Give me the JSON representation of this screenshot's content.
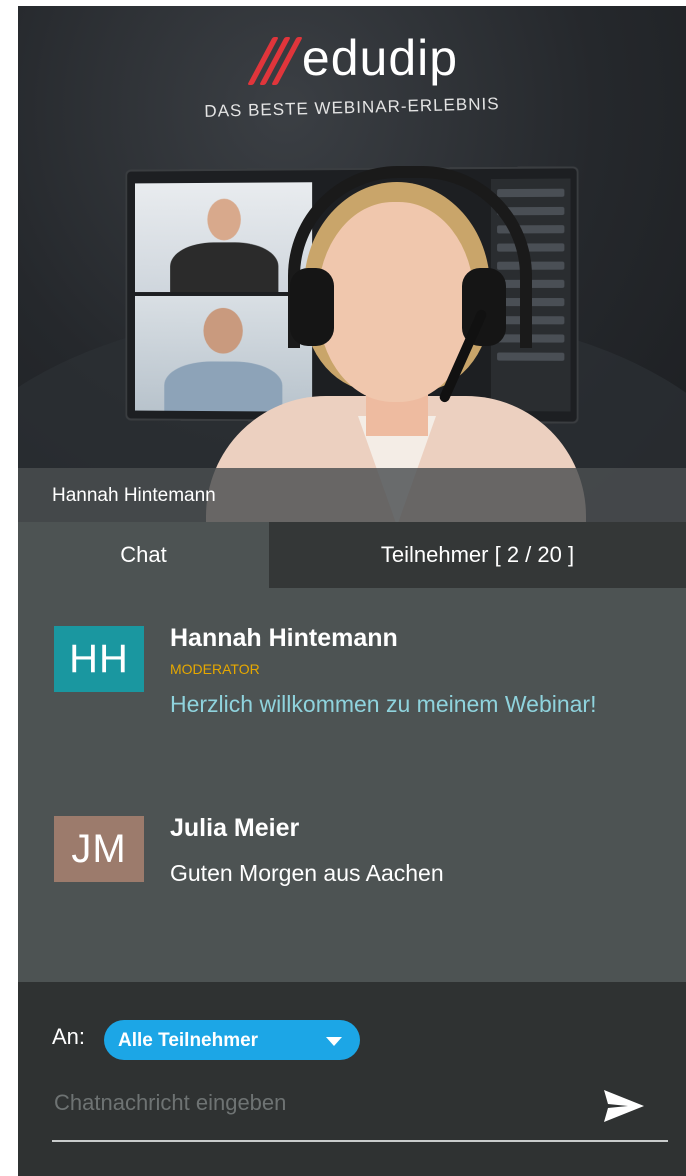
{
  "video": {
    "brand": "edudip",
    "tagline": "DAS BESTE WEBINAR-ERLEBNIS",
    "presenter_name": "Hannah Hintemann"
  },
  "tabs": [
    {
      "label": "Chat",
      "active": true
    },
    {
      "label": "Teilnehmer [ 2 / 20 ]",
      "active": false
    }
  ],
  "messages": [
    {
      "initials": "HH",
      "avatar_color": "#1a97a0",
      "sender": "Hannah Hintemann",
      "role": "MODERATOR",
      "text": "Herzlich willkommen zu meinem Webinar!"
    },
    {
      "initials": "JM",
      "avatar_color": "#9c7b6c",
      "sender": "Julia Meier",
      "role": "",
      "text": "Guten Morgen aus Aachen"
    }
  ],
  "compose": {
    "to_label": "An:",
    "recipient": "Alle Teilnehmer",
    "placeholder": "Chatnachricht eingeben"
  },
  "colors": {
    "accent": "#1ca6e6",
    "moderator": "#e6a800",
    "brand_red": "#e0353b"
  }
}
